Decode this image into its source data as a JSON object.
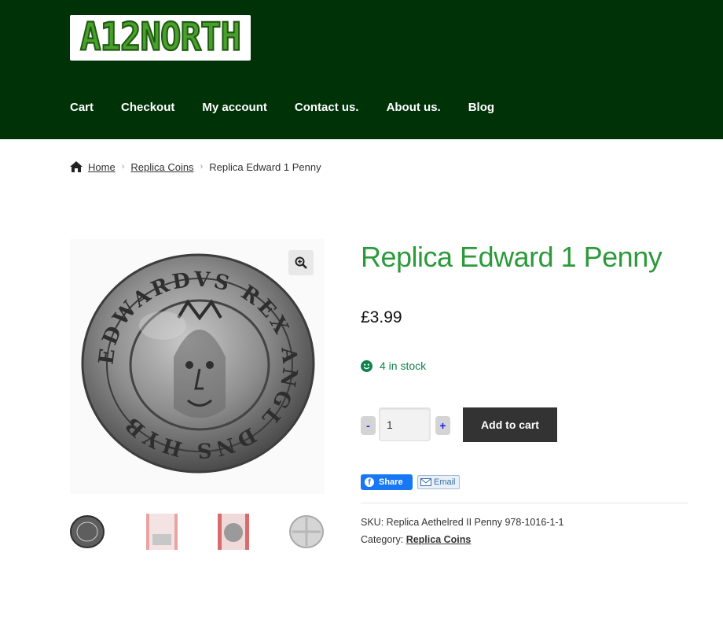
{
  "brand": {
    "logo_text": "A12NORTH"
  },
  "nav": {
    "items": [
      {
        "label": "Cart"
      },
      {
        "label": "Checkout"
      },
      {
        "label": "My account"
      },
      {
        "label": "Contact us."
      },
      {
        "label": "About us."
      },
      {
        "label": "Blog"
      }
    ]
  },
  "breadcrumb": {
    "home": "Home",
    "category": "Replica Coins",
    "current": "Replica Edward 1 Penny"
  },
  "product": {
    "title": "Replica Edward 1 Penny",
    "price": "£3.99",
    "stock": "4 in stock",
    "quantity": "1",
    "minus_label": "-",
    "plus_label": "+",
    "add_to_cart": "Add to cart",
    "coin_legend": "EDWARDVS REX ANGL DNS HYB",
    "sku_label": "SKU:",
    "sku_value": "Replica Aethelred II Penny 978-1016-1-1",
    "category_label": "Category:",
    "category_value": "Replica Coins"
  },
  "share": {
    "facebook_label": "Share",
    "email_label": "Email"
  },
  "colors": {
    "header_bg": "#003208",
    "title_green": "#2c9a3b",
    "stock_green": "#0f834d",
    "button_dark": "#333333",
    "facebook_blue": "#1877f2"
  },
  "icons": [
    "home-icon",
    "chevron-right-icon",
    "zoom-icon",
    "smiley-icon",
    "facebook-icon",
    "mail-icon"
  ]
}
